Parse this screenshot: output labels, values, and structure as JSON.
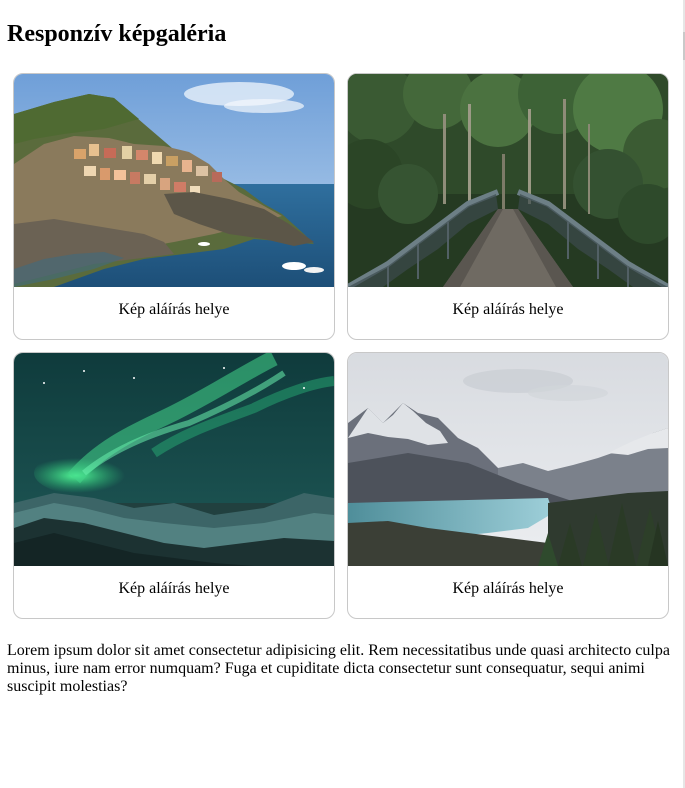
{
  "page": {
    "title": "Responzív képgaléria",
    "paragraph": "Lorem ipsum dolor sit amet consectetur adipisicing elit. Rem necessitatibus unde quasi architecto culpa minus, iure nam error numquam? Fuga et cupiditate dicta consectetur sunt consequatur, sequi animi suscipit molestias?"
  },
  "gallery": {
    "items": [
      {
        "caption": "Kép aláírás helye",
        "image": "coastal-cliff-village-photo"
      },
      {
        "caption": "Kép aláírás helye",
        "image": "forest-bridge-photo"
      },
      {
        "caption": "Kép aláírás helye",
        "image": "aurora-borealis-photo"
      },
      {
        "caption": "Kép aláírás helye",
        "image": "mountain-lake-photo"
      }
    ]
  }
}
